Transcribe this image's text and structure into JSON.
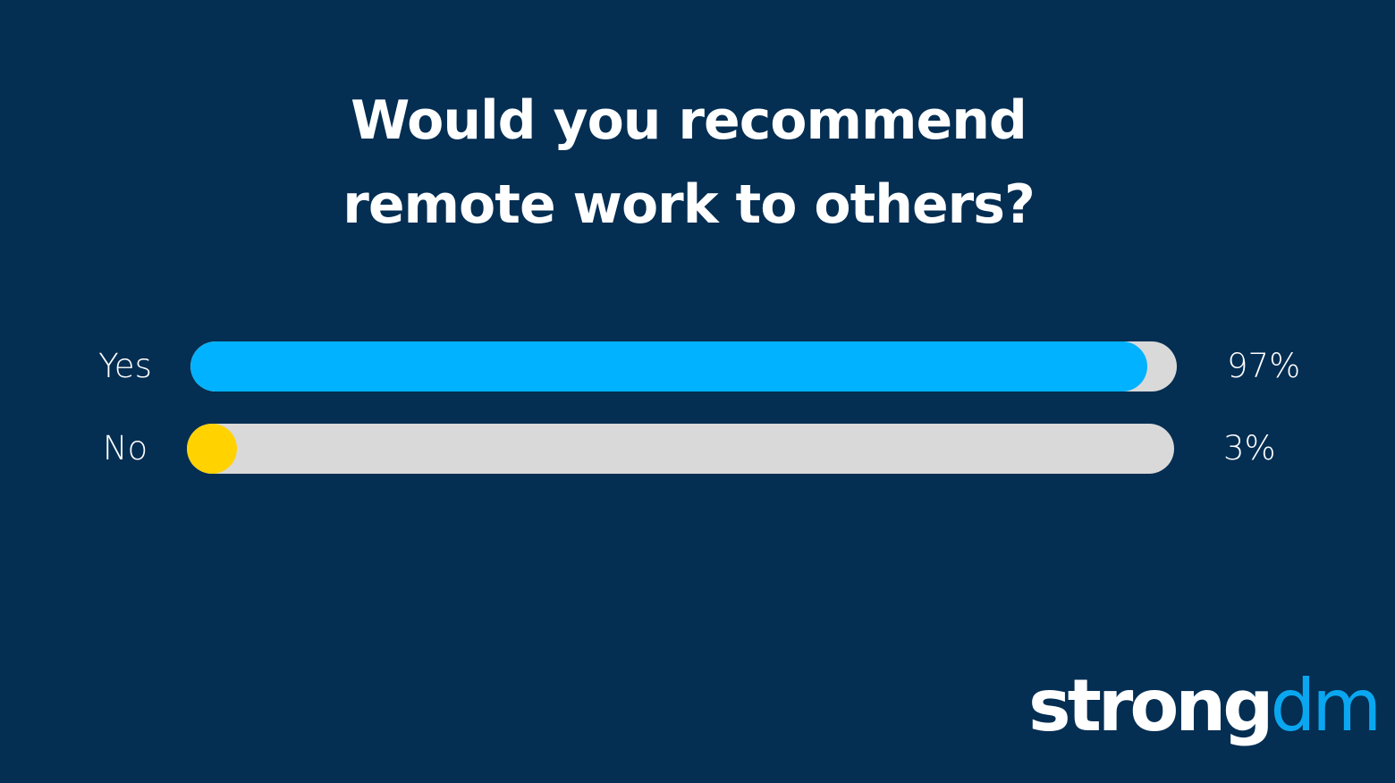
{
  "chart_data": {
    "type": "bar",
    "orientation": "horizontal",
    "title": "Would you recommend remote work to others?",
    "title_lines": [
      "Would you recommend",
      "remote work to others?"
    ],
    "categories": [
      "Yes",
      "No"
    ],
    "values": [
      97,
      3
    ],
    "value_labels": [
      "97%",
      "3%"
    ],
    "xlim": [
      0,
      100
    ],
    "grid": false,
    "legend": "none",
    "colors": [
      "#00b2ff",
      "#ffd200"
    ],
    "track_color": "#d9d9d9",
    "background": "#042e52"
  },
  "logo": {
    "text_part1": "strong",
    "text_part2": "dm",
    "color1": "#ffffff",
    "color2": "#0aa7f0"
  }
}
